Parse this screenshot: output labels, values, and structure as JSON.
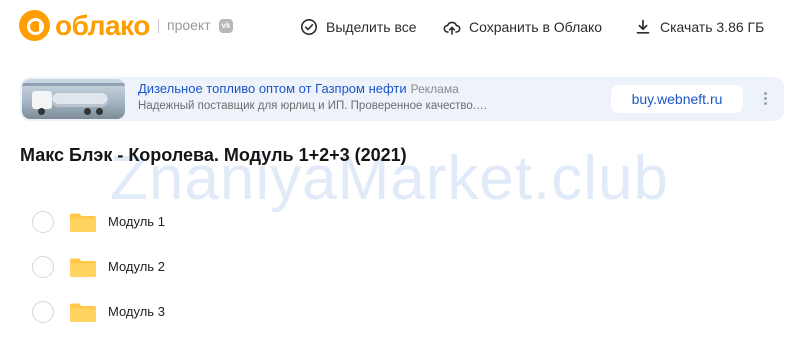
{
  "header": {
    "logo_text": "облако",
    "project_label": "проект",
    "vk_badge": "vk",
    "actions": [
      {
        "label": "Выделить все",
        "icon": "check-circle-icon"
      },
      {
        "label": "Сохранить в Облако",
        "icon": "cloud-upload-icon"
      },
      {
        "label": "Скачать 3.86 ГБ",
        "icon": "download-icon"
      }
    ]
  },
  "ad": {
    "title": "Дизельное топливо оптом от Газпром нефти",
    "tag": "Реклама",
    "description": "Надежный поставщик для юрлиц и ИП. Проверенное качество.…",
    "button_label": "buy.webneft.ru",
    "more_icon": "more-vertical-icon"
  },
  "page_title": "Макс Блэк - Королева. Модуль 1+2+3 (2021)",
  "watermark": "ZnaniyaMarket.club",
  "folders": [
    {
      "name": "Модуль 1"
    },
    {
      "name": "Модуль 2"
    },
    {
      "name": "Модуль 3"
    }
  ],
  "colors": {
    "brand": "#ff9e00",
    "link": "#1c56c6",
    "folder": "#ffc84a",
    "ad_bg": "#eef3fb"
  }
}
